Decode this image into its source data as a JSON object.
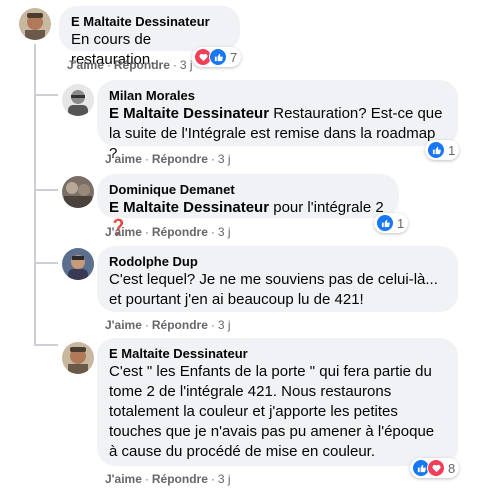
{
  "colors": {
    "like": "#1877f2",
    "love": "#f33e58",
    "bubble": "#f0f2f5",
    "meta": "#65676b"
  },
  "comments": [
    {
      "author": "E Maltaite Dessinateur",
      "text": "En cours de restauration.",
      "like_label": "J'aime",
      "reply_label": "Répondre",
      "time": "3 j",
      "reactions": [
        "love",
        "like"
      ],
      "reaction_count": "7"
    },
    {
      "author": "Milan Morales",
      "mention": "E Maltaite Dessinateur",
      "text": " Restauration? Est-ce que la suite de l'Intégrale est remise dans la roadmap ?",
      "like_label": "J'aime",
      "reply_label": "Répondre",
      "time": "3 j",
      "reactions": [
        "like"
      ],
      "reaction_count": "1"
    },
    {
      "author": "Dominique Demanet",
      "mention": "E Maltaite Dessinateur",
      "text": " pour l'intégrale 2 ",
      "emoji": "❓",
      "like_label": "J'aime",
      "reply_label": "Répondre",
      "time": "3 j",
      "reactions": [
        "like"
      ],
      "reaction_count": "1"
    },
    {
      "author": "Rodolphe Dup",
      "text": "C'est lequel? Je ne me souviens pas de celui-là... et pourtant j'en ai beaucoup lu de 421!",
      "like_label": "J'aime",
      "reply_label": "Répondre",
      "time": "3 j"
    },
    {
      "author": "E Maltaite Dessinateur",
      "text": "C'est \" les Enfants de la porte \" qui fera partie du tome 2 de l'intégrale 421. Nous restaurons totalement la couleur et j'apporte les petites touches que je n'avais pas pu amener à l'époque à cause du procédé de mise en couleur.",
      "like_label": "J'aime",
      "reply_label": "Répondre",
      "time": "3 j",
      "reactions": [
        "like",
        "love"
      ],
      "reaction_count": "8"
    }
  ]
}
